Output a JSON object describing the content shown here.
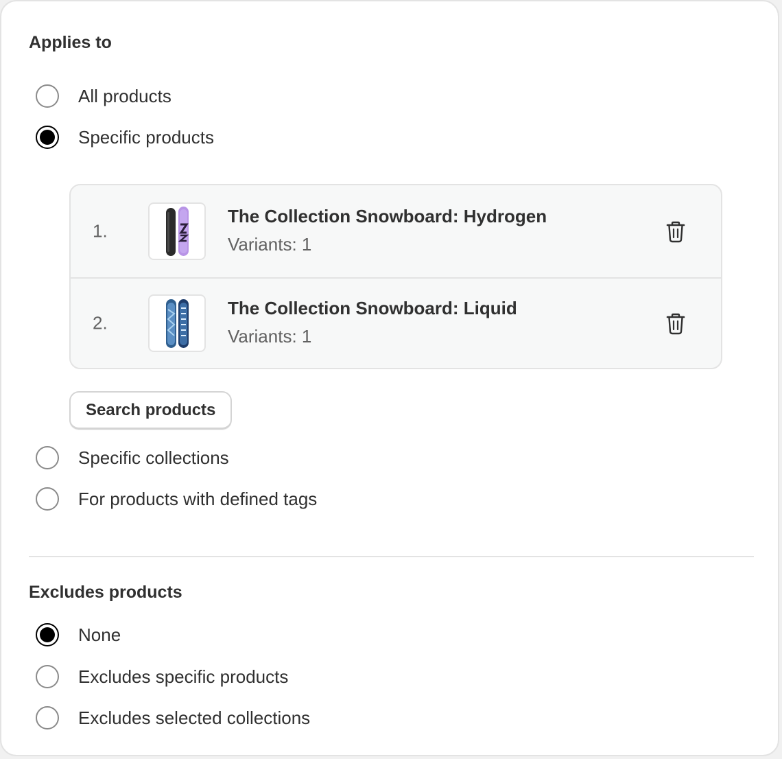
{
  "applies_to": {
    "title": "Applies to",
    "options": [
      {
        "label": "All products",
        "checked": false
      },
      {
        "label": "Specific products",
        "checked": true
      },
      {
        "label": "Specific collections",
        "checked": false
      },
      {
        "label": "For products with defined tags",
        "checked": false
      }
    ],
    "products": [
      {
        "index": "1.",
        "title": "The Collection Snowboard: Hydrogen",
        "variants": "Variants: 1",
        "thumb_icon": "snowboard-hydrogen-icon"
      },
      {
        "index": "2.",
        "title": "The Collection Snowboard: Liquid",
        "variants": "Variants: 1",
        "thumb_icon": "snowboard-liquid-icon"
      }
    ],
    "search_button": "Search products"
  },
  "excludes": {
    "title": "Excludes products",
    "options": [
      {
        "label": "None",
        "checked": true
      },
      {
        "label": "Excludes specific products",
        "checked": false
      },
      {
        "label": "Excludes selected collections",
        "checked": false
      }
    ]
  },
  "colors": {
    "text": "#303030",
    "muted": "#616161",
    "border": "#e3e3e3",
    "list_bg": "#f7f8f8",
    "radio_checked": "#000000"
  }
}
